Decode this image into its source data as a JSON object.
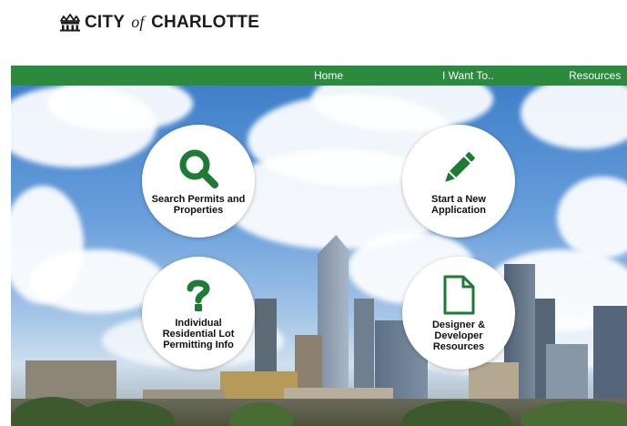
{
  "header": {
    "logo": {
      "icon": "crown-icon",
      "text_city": "CITY",
      "text_of": "of",
      "text_name": "CHARLOTTE"
    }
  },
  "nav": {
    "items": [
      {
        "label": "Home"
      },
      {
        "label": "I Want To.."
      },
      {
        "label": "Resources"
      }
    ]
  },
  "tiles": [
    {
      "label": "Search Permits and Properties",
      "icon": "search-icon"
    },
    {
      "label": "Start a New Application",
      "icon": "pencil-icon"
    },
    {
      "label": "Individual Residential Lot Permitting Info",
      "icon": "question-icon"
    },
    {
      "label": "Designer & Developer Resources",
      "icon": "document-icon"
    }
  ],
  "colors": {
    "brand_green": "#2c8a3f",
    "icon_green": "#1e7a36"
  }
}
